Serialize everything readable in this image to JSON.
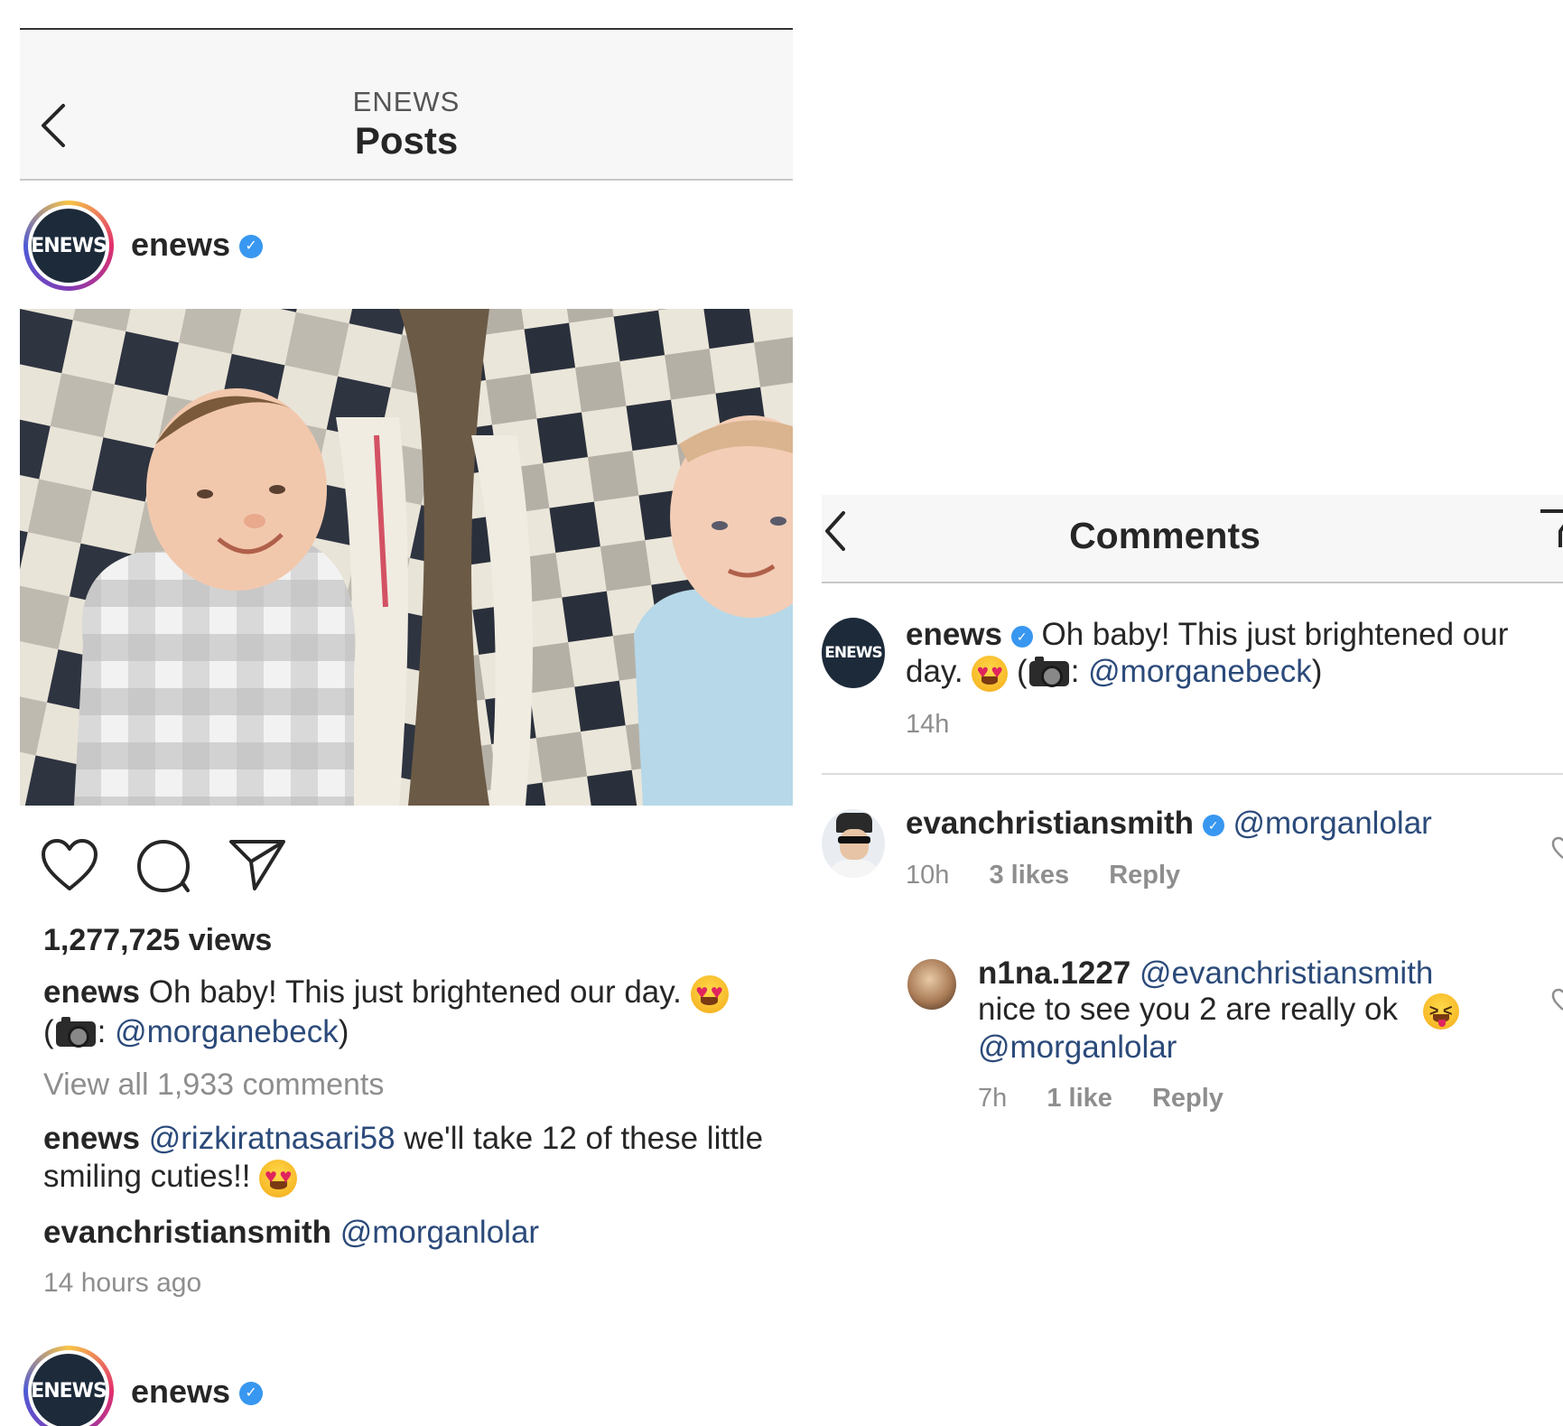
{
  "left": {
    "header": {
      "account": "ENEWS",
      "title": "Posts"
    },
    "post": {
      "username": "enews",
      "views": "1,277,725 views",
      "caption_user": "enews",
      "caption_text": "Oh baby! This just brightened our day.",
      "caption_paren_open": "(",
      "caption_colon": ":",
      "caption_mention": "@morganebeck",
      "caption_paren_close": ")",
      "view_all": "View all 1,933 comments",
      "comments": [
        {
          "user": "enews",
          "mention": "@rizkiratnasari58",
          "text": "we'll take 12 of these little smiling cuties!!"
        },
        {
          "user": "evanchristiansmith",
          "mention": "@morganlolar"
        }
      ],
      "time": "14 hours ago"
    },
    "next_post": {
      "username": "enews"
    },
    "avatar_text": "ENEWS"
  },
  "right": {
    "header": {
      "title": "Comments"
    },
    "caption": {
      "user": "enews",
      "text": "Oh baby! This just brightened our day.",
      "paren_open": "(",
      "colon": ":",
      "mention": "@morganebeck",
      "paren_close": ")",
      "time": "14h"
    },
    "comments": [
      {
        "user": "evanchristiansmith",
        "mention": "@morganlolar",
        "time": "10h",
        "likes": "3 likes",
        "reply": "Reply"
      }
    ],
    "replies": [
      {
        "user": "n1na.1227",
        "mention": "@evanchristiansmith",
        "text": "nice to see you 2 are really ok",
        "mention2": "@morganlolar",
        "time": "7h",
        "likes": "1 like",
        "reply": "Reply"
      }
    ]
  },
  "colors": {
    "mention": "#2b4a7a",
    "verified": "#3897f0",
    "grey": "#8e8e8e"
  }
}
